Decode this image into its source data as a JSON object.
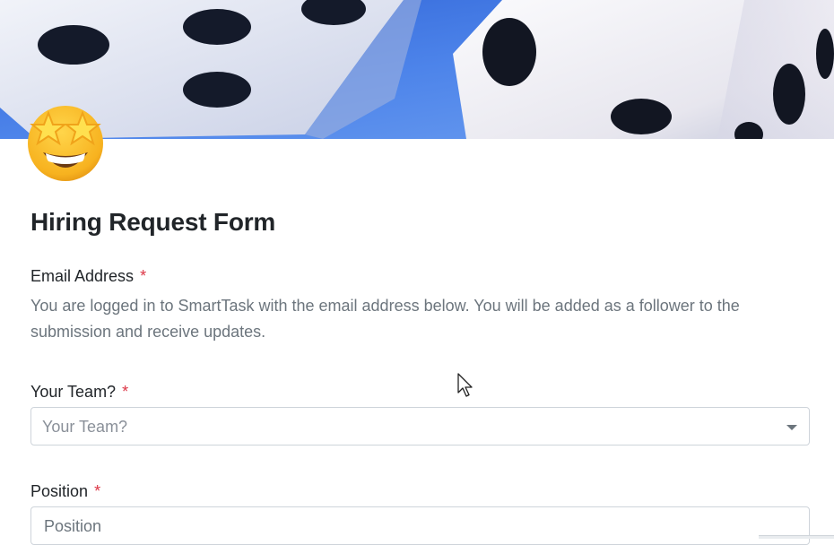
{
  "form": {
    "title": "Hiring Request Form",
    "required_marker": "*",
    "email": {
      "label": "Email Address",
      "help": "You are logged in to SmartTask with the email address below. You will be added as a follower to the submission and receive updates."
    },
    "team": {
      "label": "Your Team?",
      "placeholder": "Your Team?"
    },
    "position": {
      "label": "Position",
      "placeholder": "Position"
    }
  },
  "icons": {
    "avatar": "star-struck-emoji-icon",
    "dropdown": "caret-down-icon",
    "cursor": "mouse-pointer-icon"
  },
  "colors": {
    "required": "#dc3545",
    "help_text": "#6c757d",
    "border": "#ced4da",
    "banner_blue": "#4a7fe0"
  }
}
